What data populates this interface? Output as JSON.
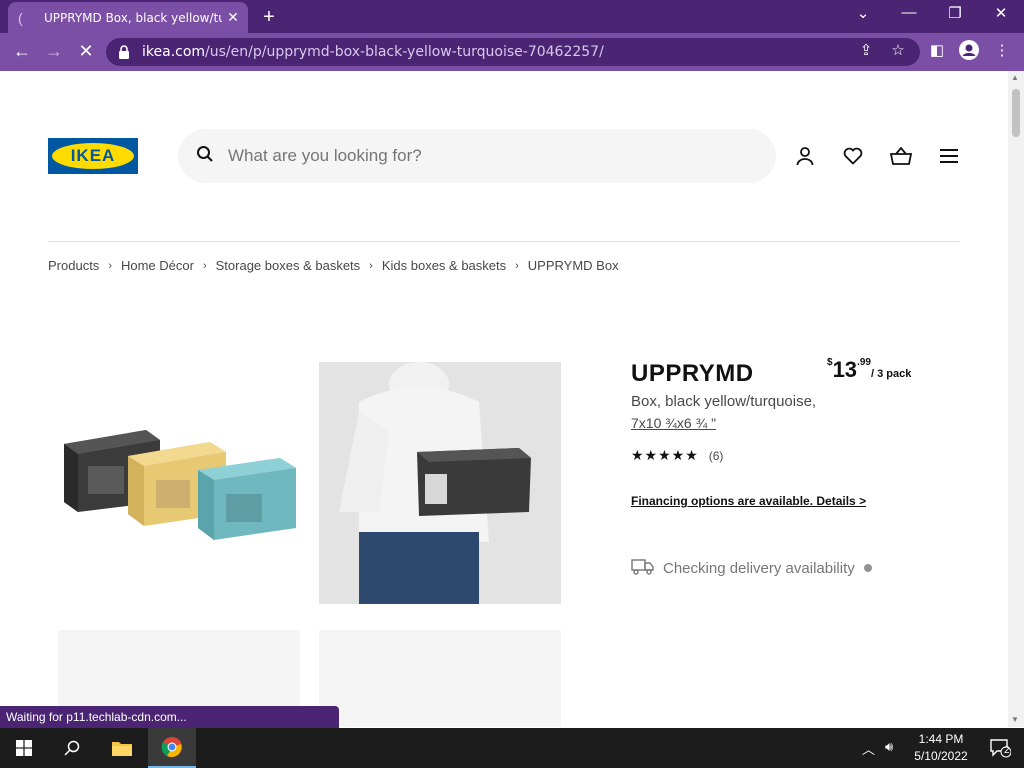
{
  "browser": {
    "tab_title": "UPPRYMD Box, black yellow/turquoise",
    "url_domain": "ikea.com",
    "url_path": "/us/en/p/upprymd-box-black-yellow-turquoise-70462257/",
    "status_text": "Waiting for p11.techlab-cdn.com..."
  },
  "header": {
    "logo_text": "IKEA",
    "search_placeholder": "What are you looking for?"
  },
  "breadcrumb": {
    "items": [
      "Products",
      "Home Décor",
      "Storage boxes & baskets",
      "Kids boxes & baskets",
      "UPPRYMD Box"
    ]
  },
  "product": {
    "name": "UPPRYMD",
    "price_currency": "$",
    "price_integer": "13",
    "price_decimal": ".99",
    "price_unit": "/ 3 pack",
    "description": "Box, black yellow/turquoise,",
    "dimensions": "7x10 ¾x6 ¾ \"",
    "rating_stars": "★★★★★",
    "rating_value": 5,
    "review_count": "(6)",
    "financing_text": "Financing options are available. Details >",
    "delivery_text": "Checking delivery availability"
  },
  "taskbar": {
    "time": "1:44 PM",
    "date": "5/10/2022",
    "notification_count": "2"
  },
  "colors": {
    "chrome_dark": "#4b2573",
    "chrome_light": "#7b4fa6",
    "ikea_blue": "#0058a3",
    "ikea_yellow": "#ffdb00"
  }
}
